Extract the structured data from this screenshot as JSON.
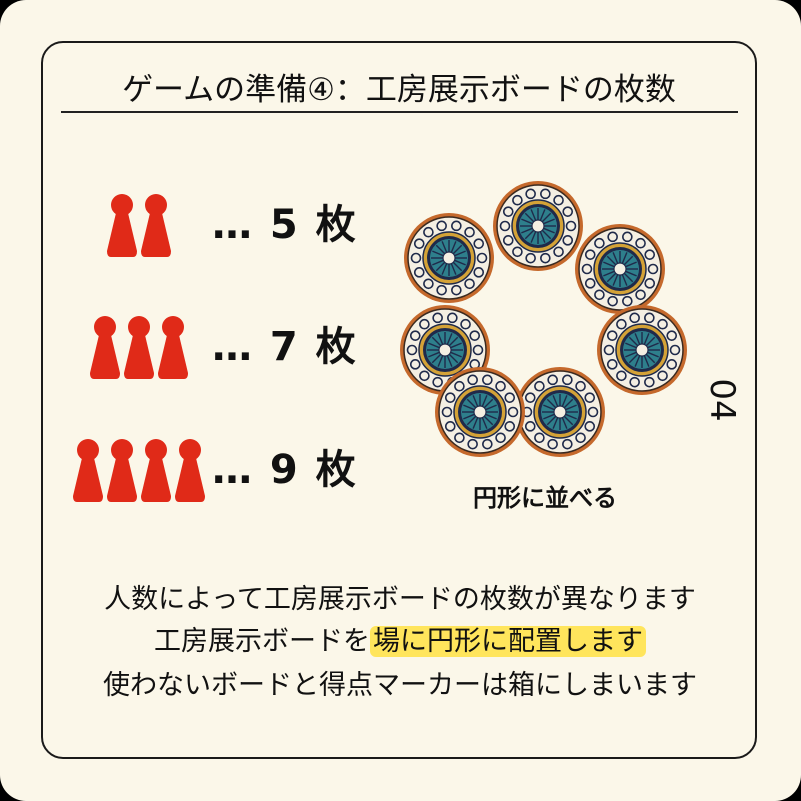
{
  "title": "ゲームの準備④：工房展示ボードの枚数",
  "colors": {
    "pawn": "#e02a18",
    "background": "#fbf7e9",
    "highlight": "#ffe55c",
    "tile_rim": "#c5692c",
    "tile_teal": "#2e7f8c",
    "tile_gold": "#d4a237",
    "tile_dark": "#1f2a4a"
  },
  "player_rows": [
    {
      "icon": "pawn-icon",
      "players": 2,
      "count_label": "… 5 枚"
    },
    {
      "icon": "pawn-icon",
      "players": 3,
      "count_label": "… 7 枚"
    },
    {
      "icon": "pawn-icon",
      "players": 4,
      "count_label": "… 9 枚"
    }
  ],
  "circle_caption": "円形に並べる",
  "circle_tiles": 7,
  "page_number": "04",
  "description": {
    "line1": "人数によって工房展示ボードの枚数が異なります",
    "line2_prefix": "工房展示ボードを",
    "line2_highlight": "場に円形に配置します",
    "line3": "使わないボードと得点マーカーは箱にしまいます"
  }
}
